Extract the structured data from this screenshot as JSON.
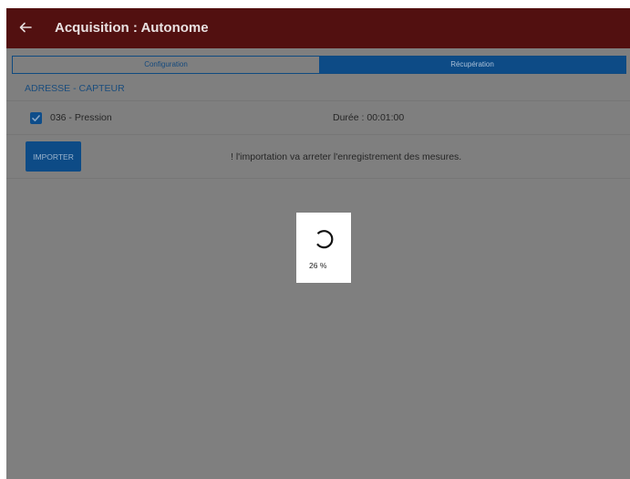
{
  "appbar": {
    "title": "Acquisition : Autonome",
    "back_icon": "arrow-left-icon"
  },
  "tabs": [
    {
      "label": "Configuration",
      "selected": false
    },
    {
      "label": "Récupération",
      "selected": true
    }
  ],
  "section": {
    "header": "ADRESSE - CAPTEUR"
  },
  "sensor_row": {
    "checked": true,
    "label": "036 - Pression",
    "duration": "Durée : 00:01:00"
  },
  "import_row": {
    "button_label": "IMPORTER",
    "warning": "! l'importation va arreter l'enregistrement des mesures."
  },
  "progress_dialog": {
    "percent": 26,
    "text": "26 %",
    "icon": "spinner-icon"
  },
  "colors": {
    "appbar": "#521010",
    "accent": "#0d4b86",
    "overlay": "#7f7f7f"
  }
}
